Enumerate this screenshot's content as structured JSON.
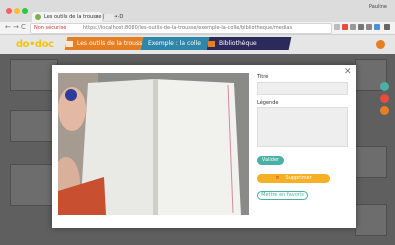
{
  "browser": {
    "tab_title": "Les outils de la trousse | Do·•·D",
    "tab_close": "×",
    "profile": "Pauline",
    "nav": {
      "back": "←",
      "forward": "→",
      "reload": "C"
    },
    "secure_label": "Non sécurisé",
    "url": "https://localhost:8080/les-outils-de-la-trousse/exemple-la-colle/bibliotheque/medias"
  },
  "app": {
    "logo": "do•doc",
    "nav_tabs": [
      {
        "label": "Les outils de la trousse",
        "color": "#e67e22"
      },
      {
        "label": "Exemple : la colle",
        "color": "#2e86ab"
      },
      {
        "label": "Bibliothèque",
        "color": "#2c2a5a"
      }
    ]
  },
  "modal": {
    "close_icon": "close-icon",
    "title_label": "Titre",
    "title_value": "",
    "caption_label": "Légende",
    "caption_value": "",
    "validate_button": "Valider",
    "delete_button": "Supprimer",
    "favorite_button": "Mettre en favoris",
    "colors": {
      "accent": "#4ab0a4",
      "delete": "#f6b026"
    }
  }
}
